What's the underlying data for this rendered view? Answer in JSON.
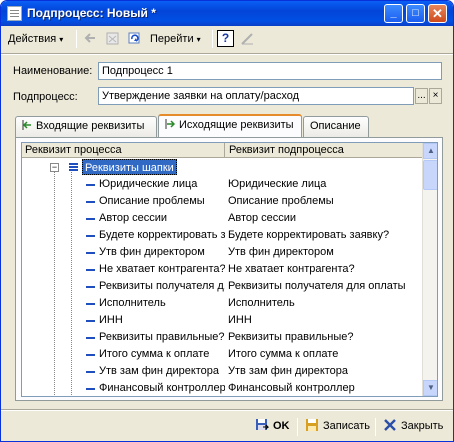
{
  "window": {
    "title": "Подпроцесс: Новый *",
    "min_glyph": "_",
    "max_glyph": "□",
    "close_glyph": "✕"
  },
  "toolbar": {
    "actions_label": "Действия",
    "goto_label": "Перейти",
    "help_glyph": "?",
    "dropdown_glyph": "▾"
  },
  "form": {
    "name_label": "Наименование:",
    "name_value": "Подпроцесс 1",
    "subprocess_label": "Подпроцесс:",
    "subprocess_value": "Утверждение заявки на оплату/расход",
    "select_glyph": "...",
    "clear_glyph": "×"
  },
  "tabs": [
    {
      "label": "Входящие реквизиты",
      "active": false
    },
    {
      "label": "Исходящие реквизиты",
      "active": true
    },
    {
      "label": "Описание",
      "active": false
    }
  ],
  "grid": {
    "col1_header": "Реквизит процесса",
    "col2_header": "Реквизит подпроцесса",
    "root_label": "Реквизиты шапки",
    "root_toggle": "−",
    "rows": [
      {
        "left": "Юридические лица",
        "right": "Юридические лица"
      },
      {
        "left": "Описание проблемы",
        "right": "Описание проблемы"
      },
      {
        "left": "Автор сессии",
        "right": "Автор сессии"
      },
      {
        "left": "Будете корректировать з...",
        "right": "Будете корректировать заявку?"
      },
      {
        "left": "Утв фин директором",
        "right": "Утв фин директором"
      },
      {
        "left": "Не хватает контрагента?",
        "right": "Не хватает контрагента?"
      },
      {
        "left": "Реквизиты получателя д...",
        "right": "Реквизиты получателя для оплаты"
      },
      {
        "left": "Исполнитель",
        "right": "Исполнитель"
      },
      {
        "left": "ИНН",
        "right": "ИНН"
      },
      {
        "left": "Реквизиты правильные?",
        "right": "Реквизиты правильные?"
      },
      {
        "left": "Итого сумма к оплате",
        "right": "Итого сумма к оплате"
      },
      {
        "left": "Утв зам фин директора",
        "right": "Утв зам фин директора"
      },
      {
        "left": "Финансовый контроллер",
        "right": "Финансовый контроллер"
      }
    ],
    "scroll_up_glyph": "▲",
    "scroll_down_glyph": "▼"
  },
  "buttons": {
    "ok_label": "OK",
    "save_label": "Записать",
    "close_label": "Закрыть"
  },
  "colors": {
    "title_bar": "#0a5ff5",
    "selection": "#316ac5",
    "active_tab_accent": "#e68b2c",
    "window_bg": "#ece9d8"
  }
}
